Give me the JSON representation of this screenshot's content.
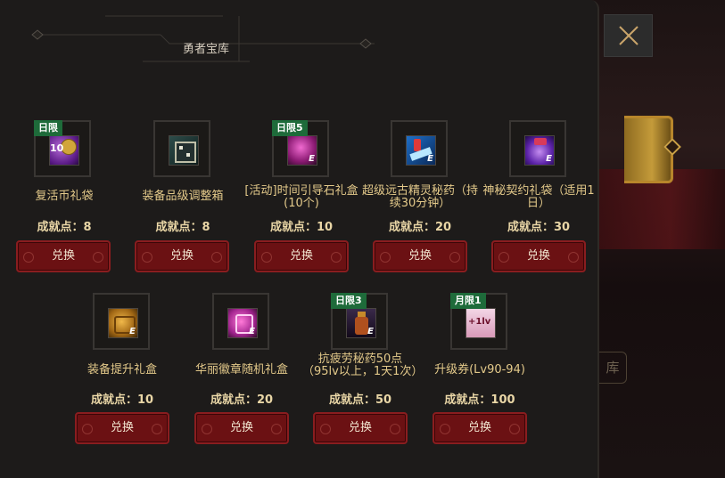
{
  "panel": {
    "title": "勇者宝库"
  },
  "colors": {
    "panel_bg": "#1d1b1a",
    "badge_green": "#1e6b3a",
    "button_red": "#6b1113",
    "text_gold": "#e3c98a"
  },
  "background": {
    "side_label": "库"
  },
  "close_button": {
    "icon": "close-icon"
  },
  "items": [
    {
      "name": "复活币礼袋",
      "points": "成就点：8",
      "badge": "日限",
      "qty": "10",
      "icon": "revival-coin-bag-icon",
      "button": "兑换"
    },
    {
      "name": "装备品级调整箱",
      "points": "成就点：8",
      "badge": "",
      "qty": "",
      "icon": "grade-adjust-box-icon",
      "button": "兑换"
    },
    {
      "name": "[活动]时间引导石礼盒 (10个)",
      "points": "成就点：10",
      "badge": "日限5",
      "qty": "",
      "icon": "time-stone-box-icon",
      "button": "兑换"
    },
    {
      "name": "超级远古精灵秘药（持续30分钟）",
      "points": "成就点：20",
      "badge": "",
      "qty": "",
      "icon": "elf-potion-icon",
      "button": "兑换"
    },
    {
      "name": "神秘契约礼袋（适用1日）",
      "points": "成就点：30",
      "badge": "",
      "qty": "",
      "icon": "contract-bag-icon",
      "button": "兑换"
    },
    {
      "name": "装备提升礼盒",
      "points": "成就点：10",
      "badge": "",
      "qty": "",
      "icon": "equip-upgrade-box-icon",
      "button": "兑换"
    },
    {
      "name": "华丽徽章随机礼盒",
      "points": "成就点：20",
      "badge": "",
      "qty": "",
      "icon": "emblem-box-icon",
      "button": "兑换"
    },
    {
      "name": "抗疲劳秘药50点（95lv以上，1天1次）",
      "points": "成就点：50",
      "badge": "日限3",
      "qty": "",
      "icon": "fatigue-potion-icon",
      "button": "兑换"
    },
    {
      "name": "升级券(Lv90-94)",
      "points": "成就点：100",
      "badge": "月限1",
      "qty": "",
      "icon": "level-up-ticket-icon",
      "button": "兑换"
    }
  ],
  "level_ticket_text": "+1lv"
}
